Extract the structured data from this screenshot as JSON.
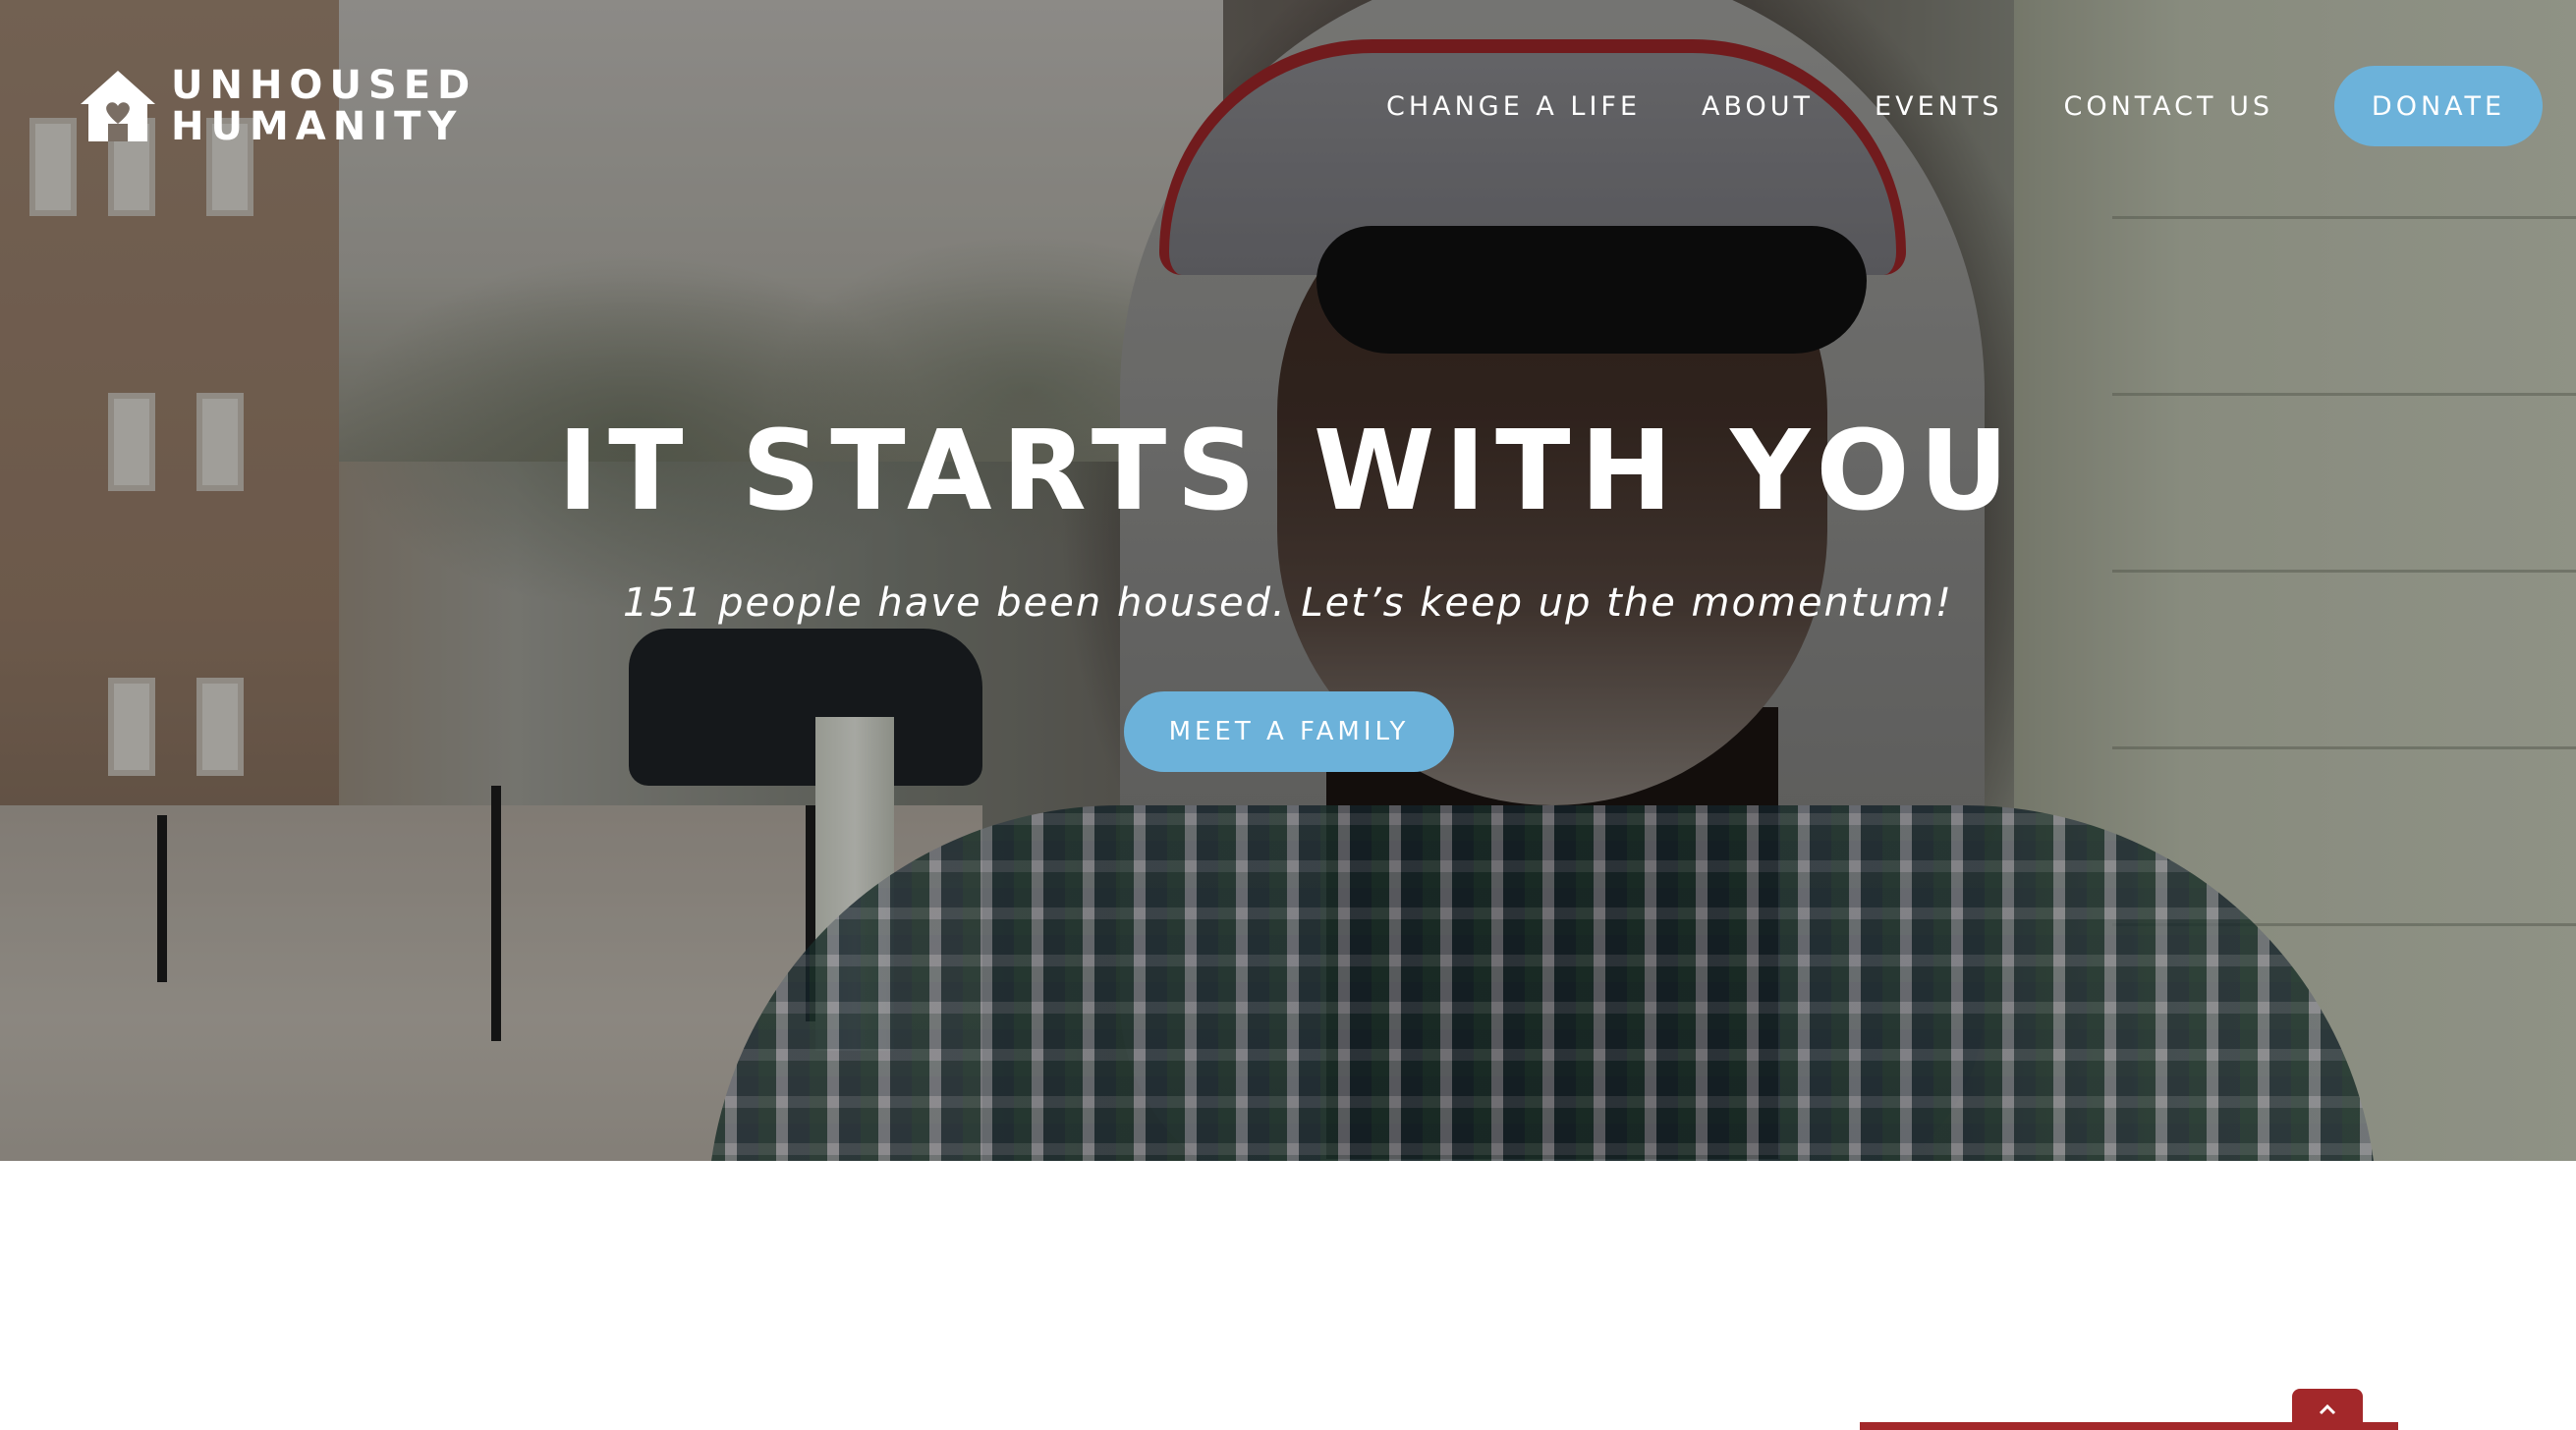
{
  "brand": {
    "line1": "UNHOUSED",
    "line2": "HUMANITY",
    "icon": "house-heart-icon"
  },
  "nav": {
    "items": [
      {
        "label": "CHANGE A LIFE"
      },
      {
        "label": "ABOUT"
      },
      {
        "label": "EVENTS"
      },
      {
        "label": "CONTACT US"
      }
    ],
    "donate_label": "DONATE"
  },
  "hero": {
    "title": "IT STARTS WITH YOU",
    "subtitle": "151 people have been housed. Let’s keep up the momentum!",
    "cta_label": "MEET A FAMILY",
    "image": "man-in-gray-hoodie-and-sunglasses-photo"
  },
  "footer": {
    "scroll_top_icon": "chevron-up-icon"
  },
  "colors": {
    "button": "#6cb2da",
    "accent_red": "#a3282a",
    "text": "#ffffff"
  }
}
